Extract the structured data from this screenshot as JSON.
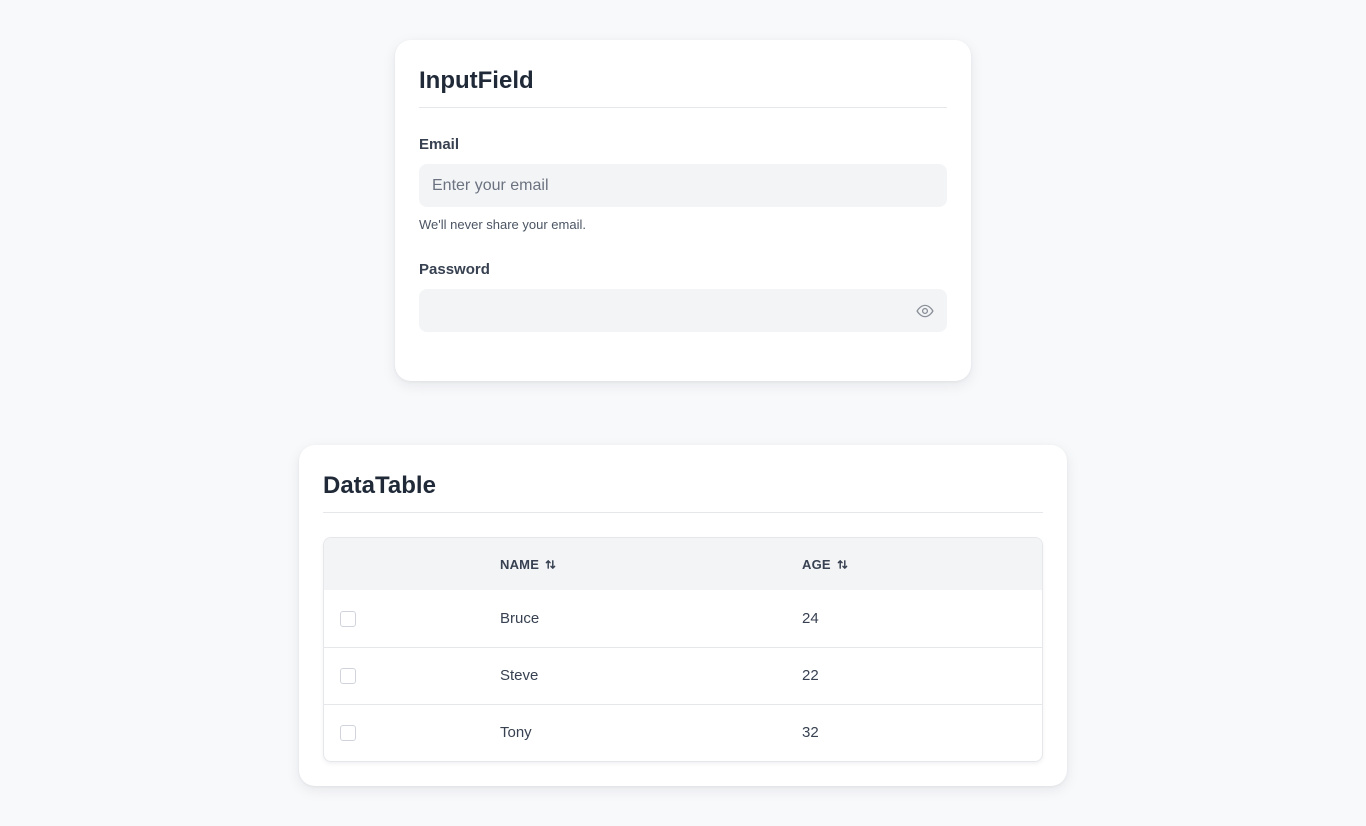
{
  "input_card": {
    "title": "InputField",
    "email": {
      "label": "Email",
      "placeholder": "Enter your email",
      "value": "",
      "helper": "We'll never share your email."
    },
    "password": {
      "label": "Password",
      "value": "",
      "toggle_icon": "eye-icon"
    }
  },
  "table_card": {
    "title": "DataTable",
    "columns": [
      {
        "label": "NAME",
        "sort_icon": "sort-icon"
      },
      {
        "label": "AGE",
        "sort_icon": "sort-icon"
      }
    ],
    "rows": [
      {
        "name": "Bruce",
        "age": "24",
        "checked": false
      },
      {
        "name": "Steve",
        "age": "22",
        "checked": false
      },
      {
        "name": "Tony",
        "age": "32",
        "checked": false
      }
    ]
  },
  "colors": {
    "background": "#f8f9fb",
    "card": "#ffffff",
    "input_bg": "#f3f4f6",
    "header_bg": "#f3f4f6",
    "text": "#1f2937",
    "muted": "#6b7280",
    "border": "#e5e7eb"
  }
}
